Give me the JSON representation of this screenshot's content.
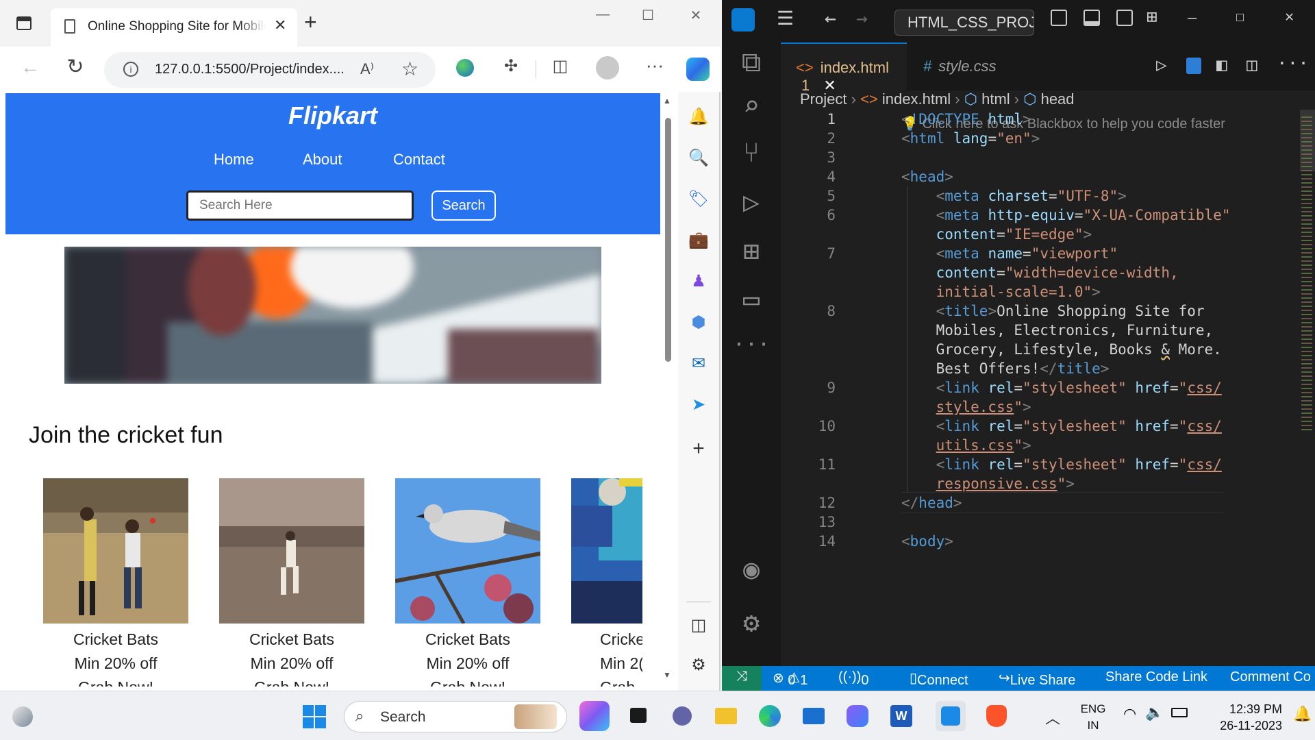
{
  "browser": {
    "tab_title": "Online Shopping Site for Mobiles",
    "url": "127.0.0.1:5500/Project/index....",
    "read_aloud_icon": "A⁾"
  },
  "site": {
    "brand": "Flipkart",
    "nav": [
      "Home",
      "About",
      "Contact"
    ],
    "search_placeholder": "Search Here",
    "search_button": "Search",
    "section_title": "Join the cricket fun",
    "cards": [
      {
        "title": "Cricket Bats",
        "offer": "Min 20% off",
        "cta": "Grab Now!"
      },
      {
        "title": "Cricket Bats",
        "offer": "Min 20% off",
        "cta": "Grab Now!"
      },
      {
        "title": "Cricket Bats",
        "offer": "Min 20% off",
        "cta": "Grab Now!"
      },
      {
        "title": "Cricke",
        "offer": "Min 2(",
        "cta": "Grab"
      }
    ]
  },
  "vscode": {
    "command_center": "HTML_CSS_PROJEC",
    "tabs": [
      {
        "label": "index.html",
        "badge": "1",
        "active": true
      },
      {
        "label": "style.css",
        "active": false
      }
    ],
    "breadcrumb": [
      "Project",
      "index.html",
      "html",
      "head"
    ],
    "blackbox_hint": "Click here to ask Blackbox to help you code faster",
    "line_numbers": [
      "1",
      "2",
      "3",
      "4",
      "5",
      "6",
      "7",
      "8",
      "9",
      "10",
      "11",
      "12",
      "13",
      "14"
    ],
    "status": {
      "errors": "0",
      "warnings": "1",
      "ports": "0",
      "connect": "Connect",
      "live_share": "Live Share",
      "share_code_link": "Share Code Link",
      "comment": "Comment Co"
    }
  },
  "taskbar": {
    "search_label": "Search",
    "lang_top": "ENG",
    "lang_bottom": "IN",
    "time": "12:39 PM",
    "date": "26-11-2023"
  },
  "colors": {
    "flipkart_blue": "#2874f0",
    "vscode_status": "#0078d4",
    "vscode_bg": "#1f1f1f"
  }
}
